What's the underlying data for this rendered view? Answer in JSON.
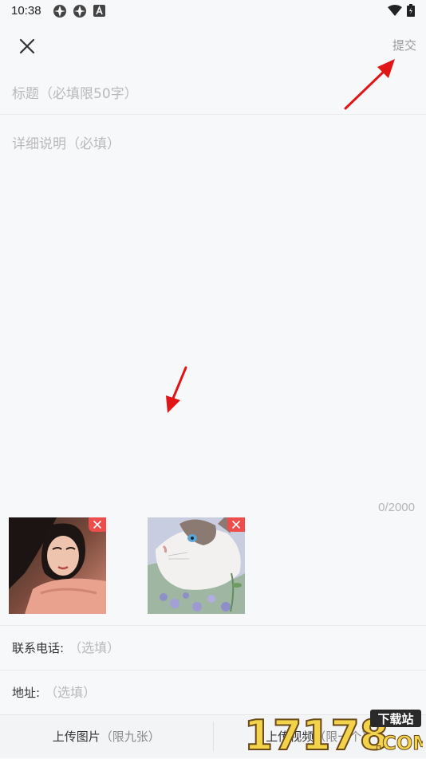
{
  "status_bar": {
    "time": "10:38"
  },
  "header": {
    "close_icon": "close-icon",
    "submit_label": "提交"
  },
  "form": {
    "title_placeholder": "标题（必填限50字）",
    "detail_placeholder": "详细说明（必填）",
    "char_counter": "0/2000",
    "phone_label": "联系电话:",
    "phone_placeholder": "（选填）",
    "address_label": "地址:",
    "address_placeholder": "（选填）"
  },
  "attachments": [
    {
      "description": "portrait photo",
      "delete_icon": "close-icon"
    },
    {
      "description": "cat photo",
      "delete_icon": "close-icon"
    }
  ],
  "bottom_bar": {
    "upload_images_label": "上传图片",
    "upload_images_hint": "（限九张）",
    "upload_video_label": "上传视频",
    "upload_video_hint": "（限一个）"
  },
  "watermark": {
    "number": "17178",
    "tag": "下载站",
    "domain": ".COM"
  },
  "colors": {
    "background": "#f7f8fa",
    "placeholder": "#b9b9b9",
    "delete_badge": "#ef4c4c",
    "annotation_arrow": "#e01515"
  }
}
